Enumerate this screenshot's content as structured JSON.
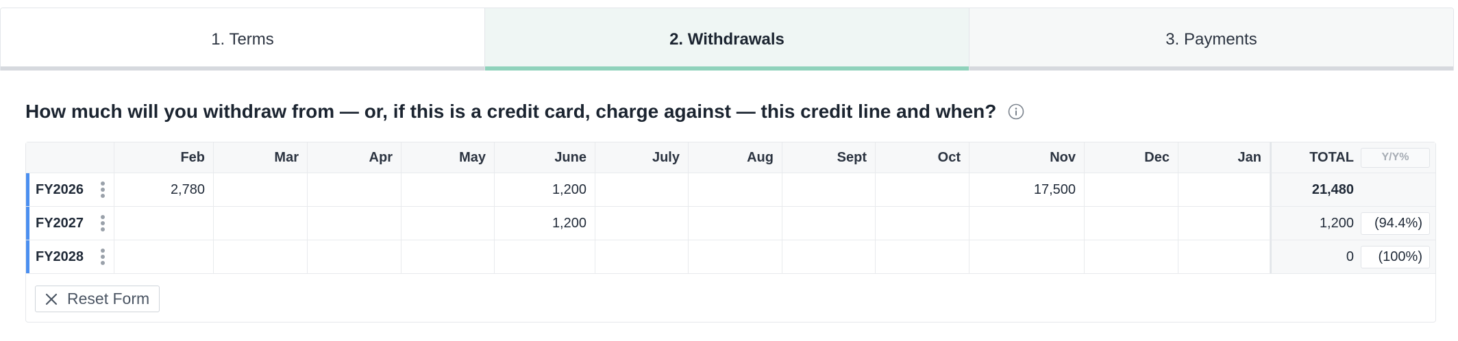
{
  "tabs": [
    {
      "label": "1. Terms",
      "state": "inactive-plain"
    },
    {
      "label": "2. Withdrawals",
      "state": "active"
    },
    {
      "label": "3. Payments",
      "state": "inactive"
    }
  ],
  "question": {
    "text": "How much will you withdraw from — or, if this is a credit card, charge against — this credit line and when?",
    "info_icon": "info-circle-icon"
  },
  "table": {
    "months": [
      "Feb",
      "Mar",
      "Apr",
      "May",
      "June",
      "July",
      "Aug",
      "Sept",
      "Oct",
      "Nov",
      "Dec",
      "Jan"
    ],
    "total_label": "TOTAL",
    "yoy_placeholder": "Y/Y%",
    "rows": [
      {
        "label": "FY2026",
        "values": [
          "2,780",
          "",
          "",
          "",
          "1,200",
          "",
          "",
          "",
          "",
          "17,500",
          "",
          ""
        ],
        "total": "21,480",
        "yoy": ""
      },
      {
        "label": "FY2027",
        "values": [
          "",
          "",
          "",
          "",
          "1,200",
          "",
          "",
          "",
          "",
          "",
          "",
          ""
        ],
        "total": "1,200",
        "yoy": "(94.4%)"
      },
      {
        "label": "FY2028",
        "values": [
          "",
          "",
          "",
          "",
          "",
          "",
          "",
          "",
          "",
          "",
          "",
          ""
        ],
        "total": "0",
        "yoy": "(100%)"
      }
    ]
  },
  "reset_button": {
    "label": "Reset Form",
    "icon": "close-icon"
  },
  "colors": {
    "accent_green": "#8fd2bb",
    "row_marker_blue": "#4b8ff0",
    "tab_active_bg": "#eff6f4"
  }
}
